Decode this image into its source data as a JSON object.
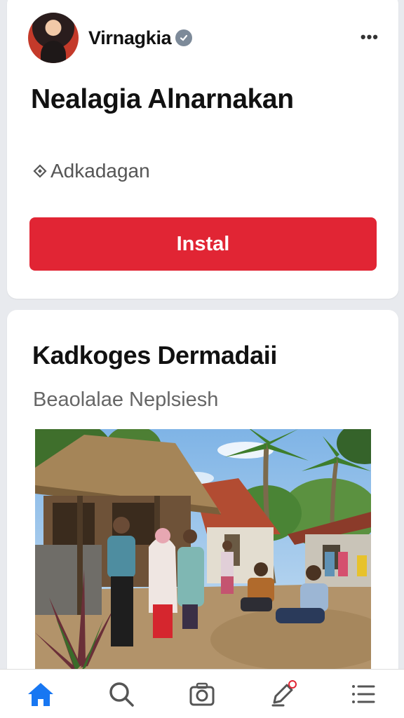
{
  "ad": {
    "advertiser_name": "Virnagkia",
    "title": "Nealagia Alnarnakan",
    "tag_label": "Adkadagan",
    "install_label": "Instal",
    "verified": true
  },
  "post": {
    "title": "Kadkoges Dermadaii",
    "subtitle": "Beaolalae Neplsiesh"
  },
  "bottom_nav": [
    {
      "icon": "home-icon",
      "active": true
    },
    {
      "icon": "search-icon",
      "active": false
    },
    {
      "icon": "camera-icon",
      "active": false
    },
    {
      "icon": "edit-icon",
      "active": false,
      "notification": true
    },
    {
      "icon": "menu-icon",
      "active": false
    }
  ],
  "colors": {
    "accent": "#e12534",
    "active_nav": "#1877f2",
    "inactive_nav": "#555555"
  }
}
